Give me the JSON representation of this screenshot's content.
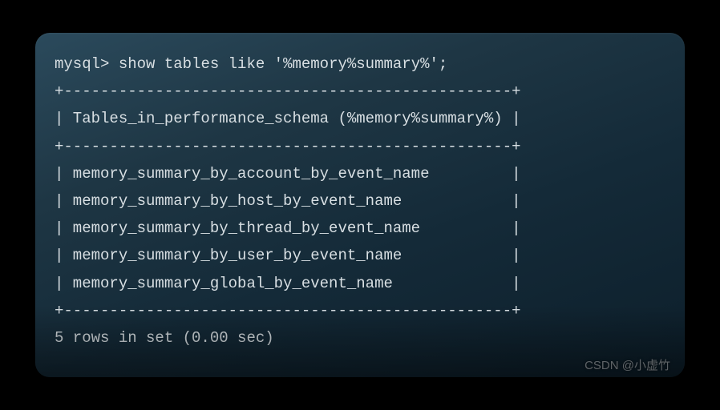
{
  "terminal": {
    "prompt": "mysql> ",
    "command": "show tables like '%memory%summary%';",
    "border_top": "+-------------------------------------------------+",
    "header": "| Tables_in_performance_schema (%memory%summary%) |",
    "border_mid": "+-------------------------------------------------+",
    "rows": [
      "| memory_summary_by_account_by_event_name         |",
      "| memory_summary_by_host_by_event_name            |",
      "| memory_summary_by_thread_by_event_name          |",
      "| memory_summary_by_user_by_event_name            |",
      "| memory_summary_global_by_event_name             |"
    ],
    "border_bot": "+-------------------------------------------------+",
    "footer": "5 rows in set (0.00 sec)"
  },
  "watermark": "CSDN @小虚竹"
}
